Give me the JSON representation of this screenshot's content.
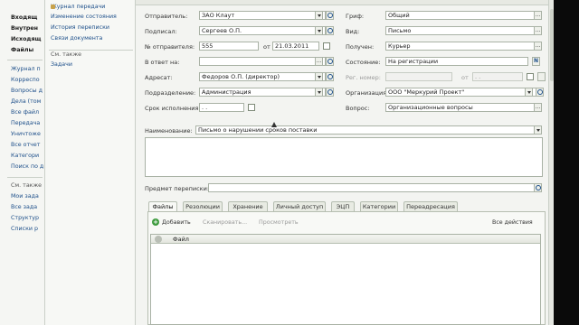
{
  "sidebar": {
    "items": [
      {
        "label": "Входящ",
        "style": "bold",
        "top": 0
      },
      {
        "label": "Внутрен",
        "style": "bold"
      },
      {
        "label": "Исходящ",
        "style": "bold"
      },
      {
        "label": "Файлы",
        "style": "bold"
      },
      {
        "label": "Журнал п"
      },
      {
        "label": "Корреспо"
      },
      {
        "label": "Вопросы д"
      },
      {
        "label": "Дела (том"
      },
      {
        "label": "Все файл"
      },
      {
        "label": "Передача"
      },
      {
        "label": "Уничтоже"
      },
      {
        "label": "Все отчет"
      },
      {
        "label": "Категори"
      },
      {
        "label": "Поиск по д"
      },
      {
        "label": "См. также",
        "style": "gray"
      },
      {
        "label": "Мои зада"
      },
      {
        "label": "Все зада"
      },
      {
        "label": "Структур"
      },
      {
        "label": "Списки р"
      }
    ]
  },
  "links": {
    "items": [
      "Журнал передачи",
      "Изменение состояния",
      "История переписки",
      "Связи документа"
    ],
    "see_also_label": "См. также",
    "see_also_items": [
      "Задачи"
    ]
  },
  "form": {
    "sender_label": "Отправитель:",
    "sender_value": "ЗАО Клаут",
    "signed_label": "Подписал:",
    "signed_value": "Сергеев О.П.",
    "sender_no_label": "№ отправителя:",
    "sender_no_value": "555",
    "from_label": "от",
    "from_value": "21.03.2011",
    "in_reply_label": "В ответ на:",
    "in_reply_value": "",
    "addressee_label": "Адресат:",
    "addressee_value": "Федоров О.П. (директор)",
    "department_label": "Подразделение:",
    "department_value": "Администрация",
    "deadline_label": "Срок исполнения:",
    "deadline_value": ". .",
    "stamp_label": "Гриф:",
    "stamp_value": "Общий",
    "type_label": "Вид:",
    "type_value": "Письмо",
    "received_label": "Получен:",
    "received_value": "Курьер",
    "state_label": "Состояние:",
    "state_value": "На регистрации",
    "reg_no_label": "Рег. номер:",
    "reg_no_value": "",
    "reg_from_label": "от",
    "reg_from_value": ". .",
    "org_label": "Организация:",
    "org_value": "ООО \"Меркурий Проект\"",
    "question_label": "Вопрос:",
    "question_value": "Организационные вопросы",
    "title_label": "Наименование:",
    "title_value": "Письмо о нарушении сроков поставки",
    "subject_label": "Предмет переписки:",
    "subject_value": ""
  },
  "tabs": [
    "Файлы",
    "Резолюции",
    "Хранение",
    "Личный доступ",
    "ЭЦП",
    "Категории",
    "Переадресация"
  ],
  "files_toolbar": {
    "add": "Добавить",
    "scan": "Сканировать...",
    "view": "Просмотреть",
    "all_actions": "Все действия"
  },
  "files_grid": {
    "columns": [
      "Файл"
    ]
  }
}
